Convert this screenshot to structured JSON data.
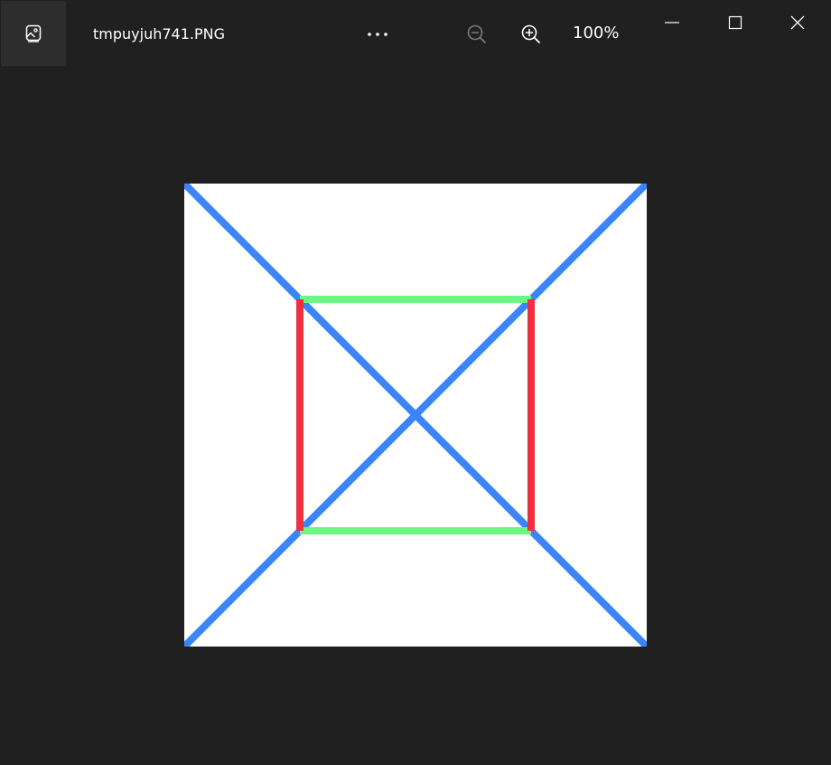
{
  "titlebar": {
    "file_name": "tmpuyjuh741.PNG",
    "zoom_level": "100%",
    "icons": {
      "app": "photos-app-icon",
      "more": "more-options-icon",
      "zoom_out": "zoom-out-icon",
      "zoom_in": "zoom-in-icon",
      "minimize": "minimize-icon",
      "maximize": "maximize-icon",
      "close": "close-icon"
    }
  },
  "image": {
    "colors": {
      "background": "#ffffff",
      "diagonals": "#3a85f9",
      "horizontal_edges": "#6cf783",
      "vertical_edges": "#ee3040"
    }
  }
}
